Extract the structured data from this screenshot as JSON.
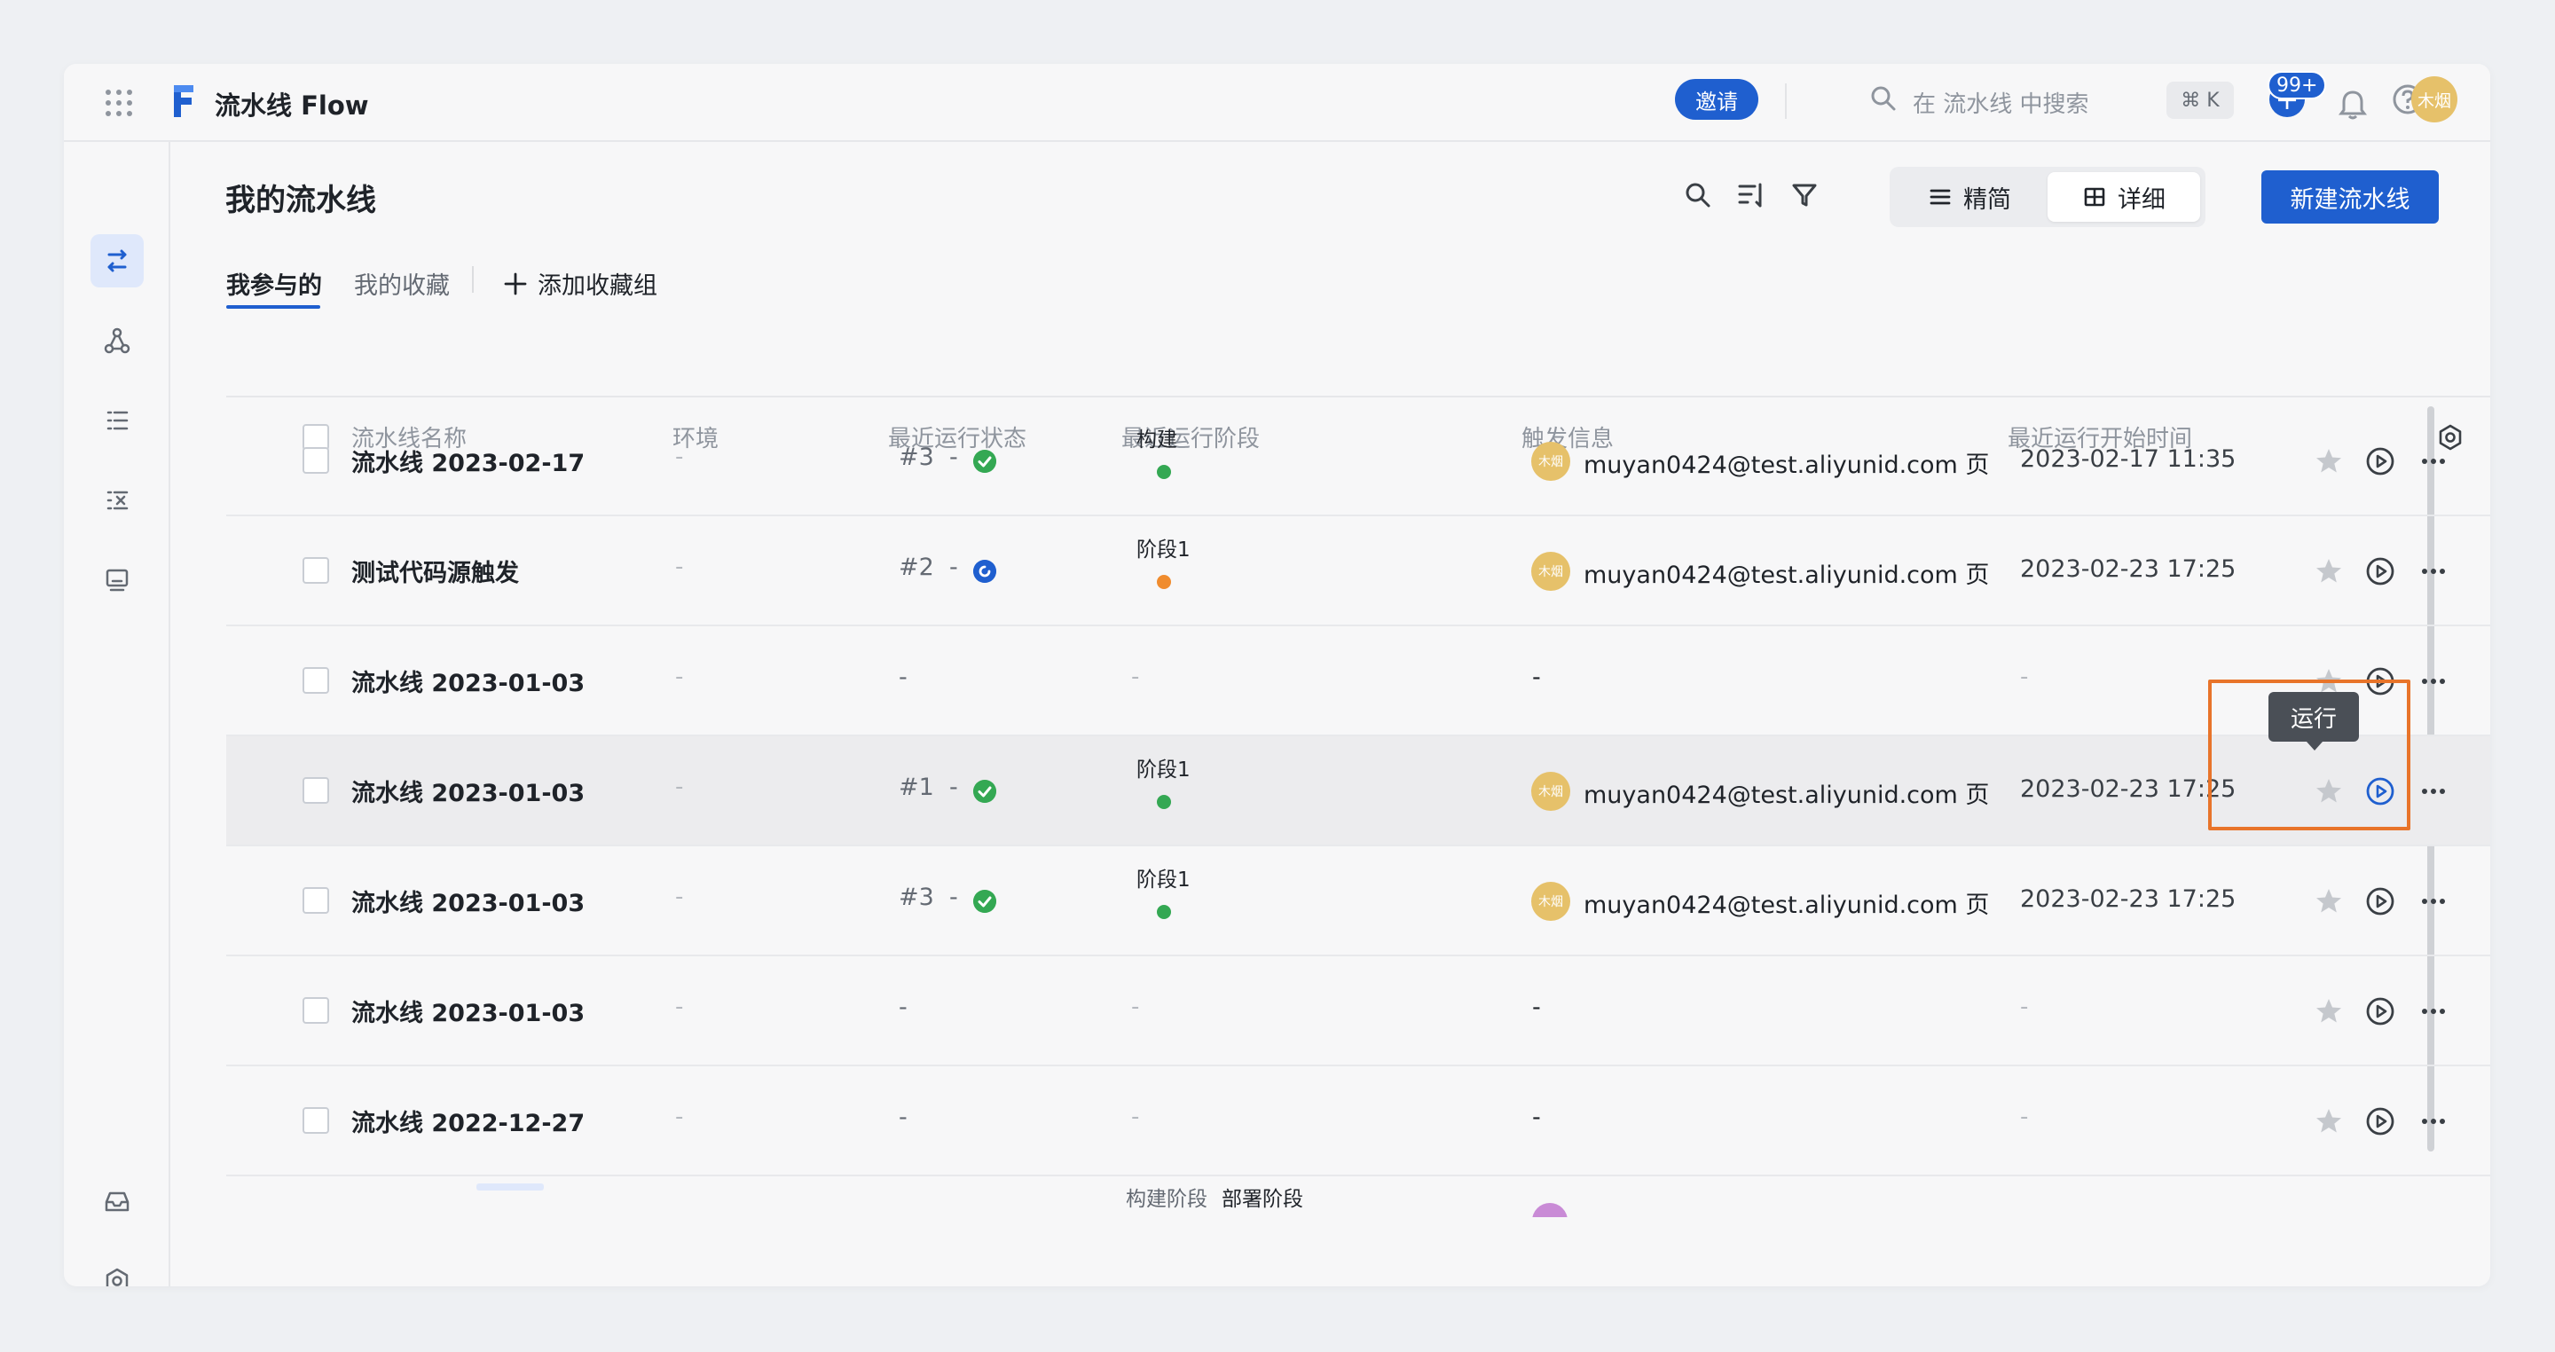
{
  "app": {
    "title": "流水线 Flow",
    "brand_color": "#1f5fcf"
  },
  "topbar": {
    "invite_label": "邀请",
    "search_placeholder": "在 流水线 中搜索",
    "shortcut": "⌘ K",
    "notification_badge": "99+",
    "user_avatar": "木烟"
  },
  "page": {
    "title": "我的流水线",
    "view_compact": "精简",
    "view_detail": "详细",
    "new_button": "新建流水线"
  },
  "tabs": [
    {
      "label": "我参与的",
      "active": true
    },
    {
      "label": "我的收藏",
      "active": false
    }
  ],
  "add_group": "添加收藏组",
  "table": {
    "headers": {
      "name": "流水线名称",
      "env": "环境",
      "status": "最近运行状态",
      "stage": "最近运行阶段",
      "trigger": "触发信息",
      "start": "最近运行开始时间"
    },
    "rows": [
      {
        "name": "流水线 2023-02-17",
        "env": "-",
        "run": "#3",
        "run_sep": "-",
        "status": "success",
        "stage": "构建",
        "stage_color": "#34a853",
        "avatar": "木烟",
        "trigger": "muyan0424@test.aliyunid.com 页",
        "time": "2023-02-17 11:35"
      },
      {
        "name": "测试代码源触发",
        "env": "-",
        "run": "#2",
        "run_sep": "-",
        "status": "running",
        "stage": "阶段1",
        "stage_color": "#f08c2e",
        "avatar": "木烟",
        "trigger": "muyan0424@test.aliyunid.com 页",
        "time": "2023-02-23 17:25"
      },
      {
        "name": "流水线 2023-01-03",
        "env": "-",
        "run": "-",
        "run_sep": "",
        "status": "",
        "stage": "-",
        "stage_color": "",
        "avatar": "",
        "trigger": "-",
        "time": "-"
      },
      {
        "name": "流水线 2023-01-03",
        "env": "-",
        "run": "#1",
        "run_sep": "-",
        "status": "success",
        "stage": "阶段1",
        "stage_color": "#34a853",
        "avatar": "木烟",
        "trigger": "muyan0424@test.aliyunid.com 页",
        "time": "2023-02-23 17:25"
      },
      {
        "name": "流水线 2023-01-03",
        "env": "-",
        "run": "#3",
        "run_sep": "-",
        "status": "success",
        "stage": "阶段1",
        "stage_color": "#34a853",
        "avatar": "木烟",
        "trigger": "muyan0424@test.aliyunid.com 页",
        "time": "2023-02-23 17:25"
      },
      {
        "name": "流水线 2023-01-03",
        "env": "-",
        "run": "-",
        "run_sep": "",
        "status": "",
        "stage": "-",
        "stage_color": "",
        "avatar": "",
        "trigger": "-",
        "time": "-"
      },
      {
        "name": "流水线 2022-12-27",
        "env": "-",
        "run": "-",
        "run_sep": "",
        "status": "",
        "stage": "-",
        "stage_color": "",
        "avatar": "",
        "trigger": "-",
        "time": "-"
      }
    ],
    "partial_row": {
      "stage_a": "构建阶段",
      "stage_b": "部署阶段"
    }
  },
  "tooltip": {
    "run_label": "运行"
  }
}
